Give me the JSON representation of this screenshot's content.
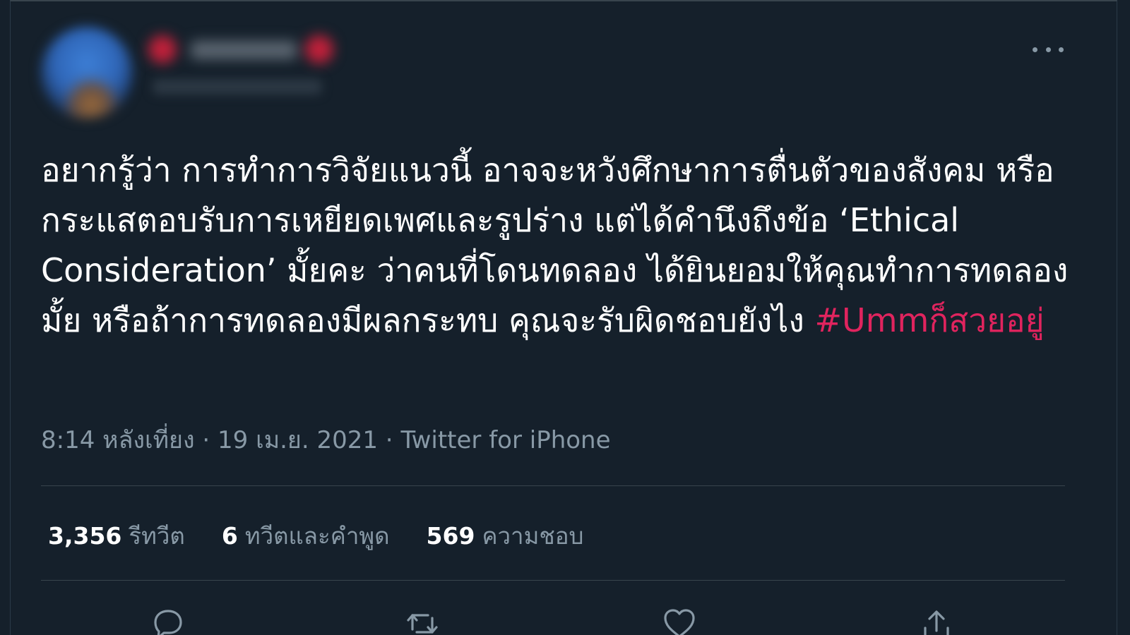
{
  "tweet": {
    "text": "อยากรู้ว่า การทำการวิจัยแนวนี้ อาจจะหวังศึกษาการตื่นตัวของสังคม หรือกระแสตอบรับการเหยียดเพศและรูปร่าง แต่ได้คำนึงถึงข้อ ‘Ethical Consideration’ มั้ยคะ ว่าคนที่โดนทดลอง ได้ยินยอมให้คุณทำการทดลองมั้ย หรือถ้าการทดลองมีผลกระทบ คุณจะรับผิดชอบยังไง ",
    "hashtag": "#Ummก็สวยอยู่",
    "time": "8:14 หลังเที่ยง",
    "separator": " · ",
    "date": "19 เม.ย. 2021",
    "source": "Twitter for iPhone"
  },
  "stats": {
    "retweets_count": "3,356",
    "retweets_label": "รีทวีต",
    "quotes_count": "6",
    "quotes_label": "ทวีตและคำพูด",
    "likes_count": "569",
    "likes_label": "ความชอบ"
  },
  "icons": {
    "more": "more-horizontal-icon",
    "reply": "reply-icon",
    "retweet": "retweet-icon",
    "like": "heart-icon",
    "share": "share-icon"
  },
  "colors": {
    "background": "#15202b",
    "text": "#ffffff",
    "muted": "#8899a6",
    "hashtag": "#e0245e",
    "divider": "#38444d"
  }
}
